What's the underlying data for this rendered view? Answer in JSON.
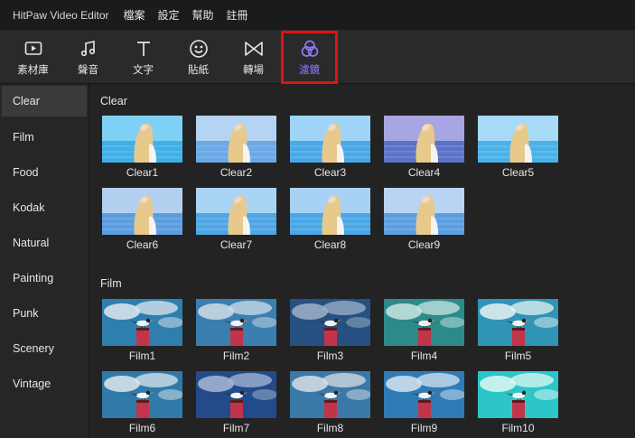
{
  "app": {
    "title": "HitPaw Video Editor"
  },
  "menu": [
    "檔案",
    "設定",
    "幫助",
    "註冊"
  ],
  "toolbar": [
    {
      "label": "素材庫",
      "icon": "media-library-icon"
    },
    {
      "label": "聲音",
      "icon": "music-note-icon"
    },
    {
      "label": "文字",
      "icon": "text-icon"
    },
    {
      "label": "貼紙",
      "icon": "sticker-face-icon"
    },
    {
      "label": "轉場",
      "icon": "transition-bowtie-icon"
    },
    {
      "label": "濾鏡",
      "icon": "filter-circles-icon",
      "active": true
    }
  ],
  "sidebar": [
    "Clear",
    "Film",
    "Food",
    "Kodak",
    "Natural",
    "Painting",
    "Punk",
    "Scenery",
    "Vintage"
  ],
  "sections": {
    "clear": {
      "title": "Clear",
      "items": [
        "Clear1",
        "Clear2",
        "Clear3",
        "Clear4",
        "Clear5",
        "Clear6",
        "Clear7",
        "Clear8",
        "Clear9"
      ]
    },
    "film": {
      "title": "Film",
      "items": [
        "Film1",
        "Film2",
        "Film3",
        "Film4",
        "Film5",
        "Film6",
        "Film7",
        "Film8",
        "Film9",
        "Film10"
      ]
    }
  },
  "colors": {
    "accent": "#8d79ff",
    "highlight": "#e01313",
    "background": "#232323"
  }
}
